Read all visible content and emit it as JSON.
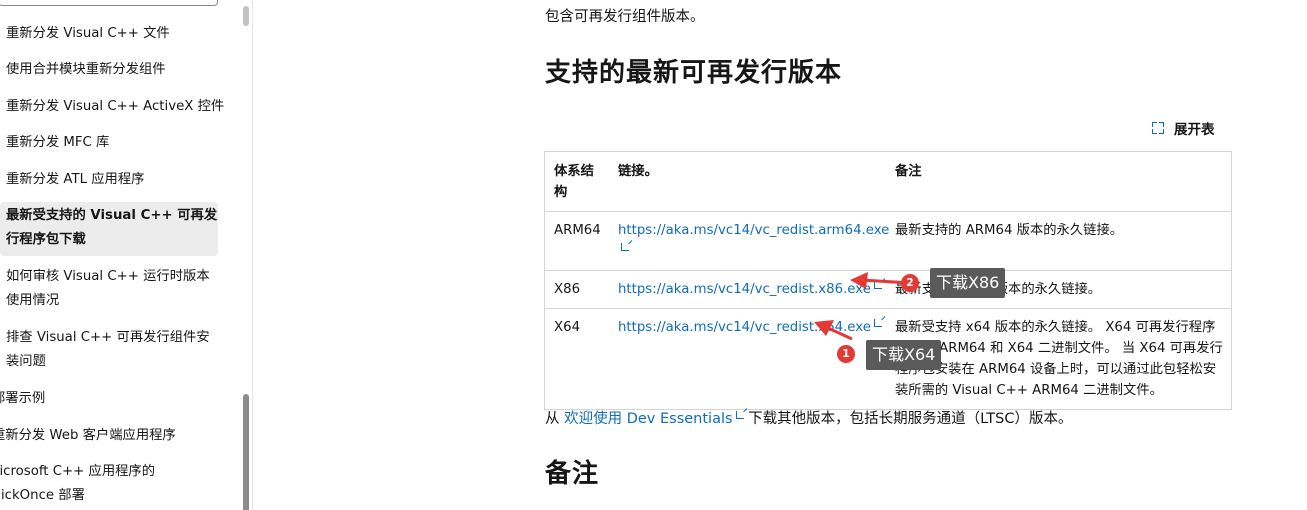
{
  "sidebar": {
    "items": [
      {
        "label": "重新分发 Visual C++ 文件"
      },
      {
        "label": "使用合并模块重新分发组件"
      },
      {
        "label": "重新分发 Visual C++ ActiveX 控件"
      },
      {
        "label": "重新分发 MFC 库"
      },
      {
        "label": "重新分发 ATL 应用程序"
      },
      {
        "label1": "最新受支持的 Visual C++ 可再发",
        "label2": "行程序包下载"
      },
      {
        "label1": "如何审核 Visual C++ 运行时版本",
        "label2": "使用情况"
      },
      {
        "label1": "排查 Visual C++ 可再发行组件安",
        "label2": "装问题"
      },
      {
        "label": "部署示例"
      },
      {
        "label": "重新分发 Web 客户端应用程序"
      },
      {
        "label1": "Microsoft C++ 应用程序的",
        "label2": "ClickOnce 部署"
      }
    ]
  },
  "main": {
    "intro": "包含可再发行组件版本。",
    "heading": "支持的最新可再发行版本",
    "expand_label": "展开表",
    "table": {
      "headers": [
        "体系结构",
        "链接。",
        "备注"
      ],
      "rows": [
        {
          "arch": "ARM64",
          "link": "https://aka.ms/vc14/vc_redist.arm64.exe",
          "note": "最新支持的 ARM64 版本的永久链接。"
        },
        {
          "arch": "X86",
          "link": "https://aka.ms/vc14/vc_redist.x86.exe",
          "note": "最新支持的 x86 版本的永久链接。"
        },
        {
          "arch": "X64",
          "link": "https://aka.ms/vc14/vc_redist.x64.exe",
          "note": "最新受支持 x64 版本的永久链接。 X64 可再发行程序包包含 ARM64 和 X64 二进制文件。 当 X64 可再发行程序包安装在 ARM64 设备上时，可以通过此包轻松安装所需的 Visual C++ ARM64 二进制文件。"
        }
      ]
    },
    "dev_prefix": "从 ",
    "dev_link": "欢迎使用 Dev Essentials",
    "dev_suffix": " 下载其他版本，包括长期服务通道（LTSC）版本。",
    "heading2": "备注"
  },
  "annotations": [
    {
      "number": "1",
      "label": "下载X64"
    },
    {
      "number": "2",
      "label": "下载X86"
    }
  ],
  "colors": {
    "link": "#0f6cbd",
    "annotation": "#e53935",
    "tag_bg": "#5a5a5a"
  }
}
